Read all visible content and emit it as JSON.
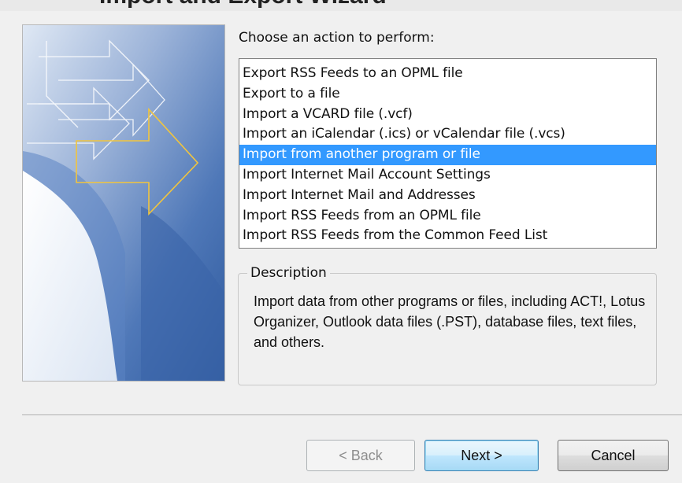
{
  "header": {
    "clipped_title": "Import and Export Wizard"
  },
  "wizard": {
    "prompt": "Choose an action to perform:",
    "actions": [
      {
        "label": "Export RSS Feeds to an OPML file",
        "selected": false
      },
      {
        "label": "Export to a file",
        "selected": false
      },
      {
        "label": "Import a VCARD file (.vcf)",
        "selected": false
      },
      {
        "label": "Import an iCalendar (.ics) or vCalendar file (.vcs)",
        "selected": false
      },
      {
        "label": "Import from another program or file",
        "selected": true
      },
      {
        "label": "Import Internet Mail Account Settings",
        "selected": false
      },
      {
        "label": "Import Internet Mail and Addresses",
        "selected": false
      },
      {
        "label": "Import RSS Feeds from an OPML file",
        "selected": false
      },
      {
        "label": "Import RSS Feeds from the Common Feed List",
        "selected": false
      }
    ],
    "description": {
      "legend": "Description",
      "text": "Import data from other programs or files, including ACT!, Lotus Organizer, Outlook data files (.PST), database files, text files, and others."
    }
  },
  "buttons": {
    "back": "< Back",
    "next": "Next >",
    "cancel": "Cancel"
  },
  "colors": {
    "selection": "#3399ff",
    "dialog_bg": "#f0f0f0",
    "arrow_highlight": "#f2c53d",
    "art_blue": "#3f68aa"
  }
}
